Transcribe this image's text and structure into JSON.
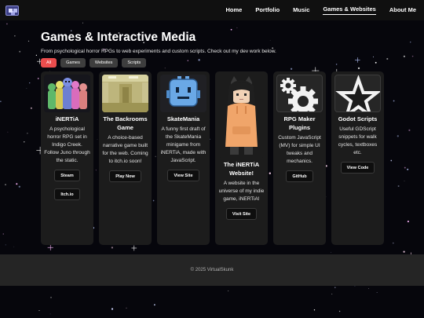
{
  "nav": {
    "links": [
      {
        "label": "Home"
      },
      {
        "label": "Portfolio"
      },
      {
        "label": "Music"
      },
      {
        "label": "Games & Websites"
      },
      {
        "label": "About Me"
      }
    ],
    "active": "Games & Websites"
  },
  "header": {
    "title": "Games & Interactive Media",
    "subtitle": "From psychological horror RPGs to web experiments and custom scripts. Check out my dev work below."
  },
  "filters": [
    {
      "label": "All",
      "active": true
    },
    {
      "label": "Games",
      "active": false
    },
    {
      "label": "Websites",
      "active": false
    },
    {
      "label": "Scripts",
      "active": false
    }
  ],
  "cards": [
    {
      "title": "iNERTiA",
      "description": "A psychological horror RPG set in Indigo Creek. Follow Juno through the static.",
      "buttons": [
        "Steam",
        "Itch.io"
      ],
      "thumbnail": "character-group-art"
    },
    {
      "title": "The Backrooms Game",
      "description": "A choice-based narrative game built for the web. Coming to itch.io soon!",
      "buttons": [
        "Play Now"
      ],
      "thumbnail": "yellow-hallway-photo"
    },
    {
      "title": "SkateMania",
      "description": "A funny first draft of the SkateMania minigame from iNERTiA, made with JavaScript.",
      "buttons": [
        "View Site"
      ],
      "thumbnail": "blue-robot-sprite"
    },
    {
      "title": "The iNERTiA Website!",
      "description": "A website in the universe of my indie game, iNERTiA!",
      "buttons": [
        "Visit Site"
      ],
      "thumbnail": "character-in-orange-hoodie"
    },
    {
      "title": "RPG Maker Plugins",
      "description": "Custom JavaScript (MV) for simple UI tweaks and mechanics.",
      "buttons": [
        "GitHub"
      ],
      "thumbnail": "gear-icon"
    },
    {
      "title": "Godot Scripts",
      "description": "Useful GDScript snippets for walk cycles, textboxes etc.",
      "buttons": [
        "View Code"
      ],
      "thumbnail": "star-icon"
    }
  ],
  "footer": {
    "copyright": "© 2025 VirtualSkunk"
  },
  "colors": {
    "accent": "#ea4d4d",
    "background": "#06060c",
    "card": "#1c1c1c",
    "nav": "#101010",
    "footer": "#252525"
  }
}
